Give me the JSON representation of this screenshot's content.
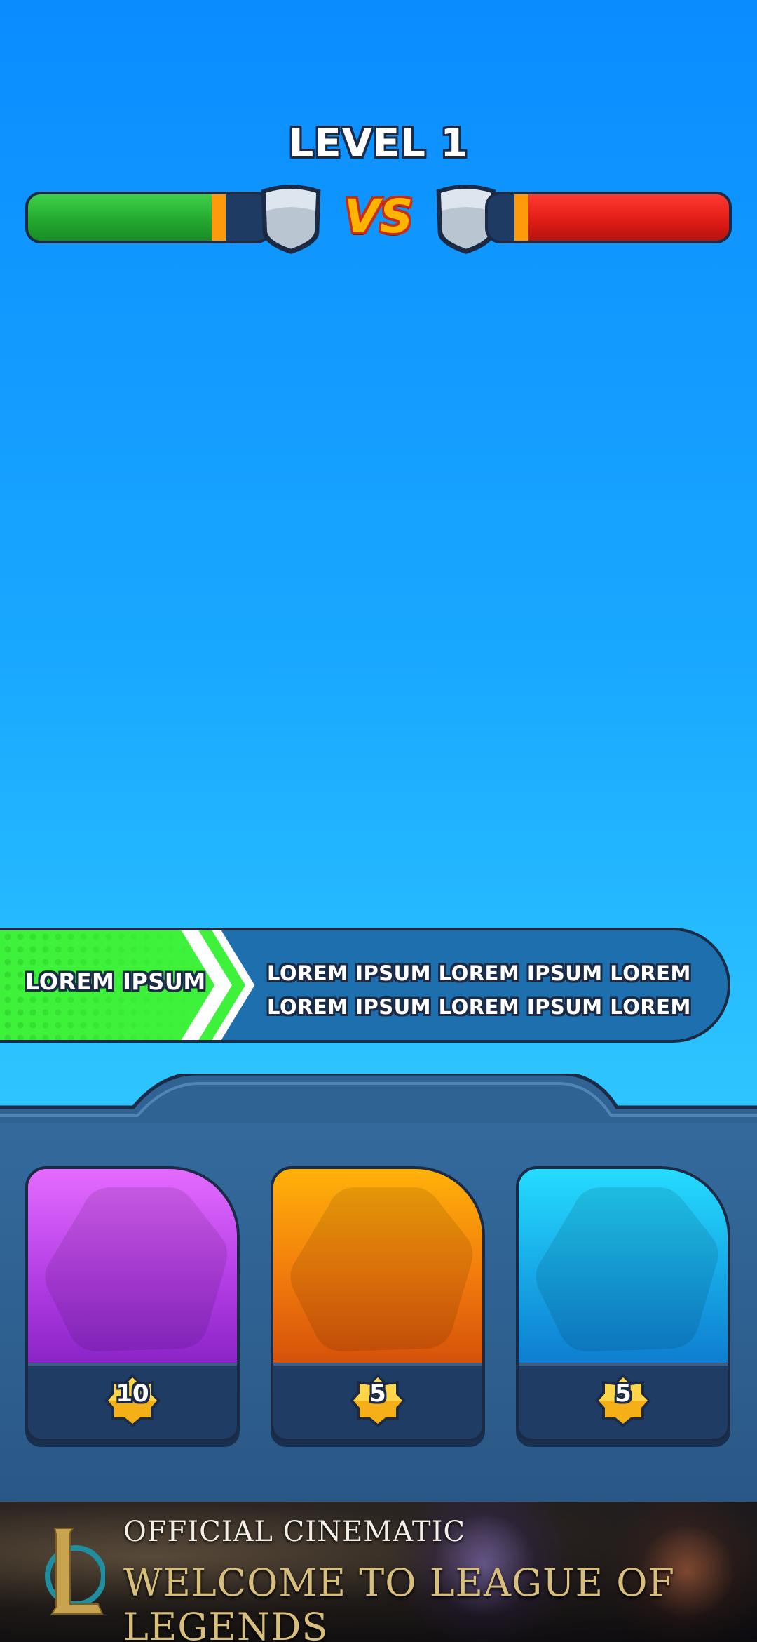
{
  "header": {
    "level_title": "LEVEL 1",
    "vs_label": "VS"
  },
  "players": {
    "left": {
      "health_fraction": 0.8,
      "color": "#23a92f"
    },
    "right": {
      "health_fraction": 0.85,
      "color": "#e21c16"
    }
  },
  "banner": {
    "label": "LOREM IPSUM",
    "line1": "LOREM IPSUM LOREM IPSUM LOREM",
    "line2": "LOREM IPSUM LOREM IPSUM LOREM"
  },
  "cards": [
    {
      "color": "purple",
      "cost": "10"
    },
    {
      "color": "orange",
      "cost": "5"
    },
    {
      "color": "cyan",
      "cost": "5"
    }
  ],
  "ad": {
    "subtitle": "OFFICIAL CINEMATIC",
    "title": "WELCOME TO LEAGUE OF LEGENDS",
    "logo_letter": "L"
  }
}
